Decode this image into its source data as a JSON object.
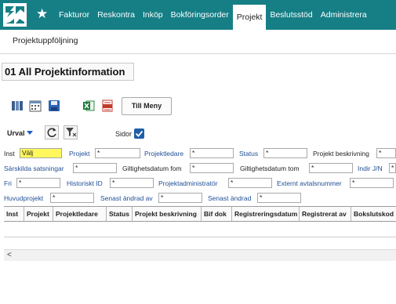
{
  "nav": {
    "star": "★",
    "items": [
      {
        "label": "Fakturor"
      },
      {
        "label": "Reskontra"
      },
      {
        "label": "Inköp"
      },
      {
        "label": "Bokföringsorder"
      },
      {
        "label": "Projekt",
        "active": true
      },
      {
        "label": "Beslutsstöd"
      },
      {
        "label": "Administrera"
      }
    ]
  },
  "subnav": {
    "label": "Projektuppföljning"
  },
  "page": {
    "title": "01 All Projektinformation"
  },
  "toolbar": {
    "meny_label": "Till Meny",
    "icons": [
      "columns-icon",
      "calendar-icon",
      "save-icon",
      "excel-icon",
      "pdf-icon"
    ]
  },
  "urval": {
    "label": "Urval",
    "sidor_label": "Sidor",
    "sidor_checked": true
  },
  "form": {
    "inst": {
      "label": "Inst",
      "value": "Välj"
    },
    "projekt": {
      "label": "Projekt",
      "value": "*"
    },
    "projektledare": {
      "label": "Projektledare",
      "value": "*"
    },
    "status": {
      "label": "Status",
      "value": "*"
    },
    "projekt_beskrivning": {
      "label": "Projekt beskrivning",
      "value": "*"
    },
    "sarskilda": {
      "label": "Särskilda satsningar",
      "value": "*"
    },
    "giltig_fom": {
      "label": "Giltighetsdatum fom",
      "value": "*"
    },
    "giltig_tom": {
      "label": "Giltighetsdatum tom",
      "value": "*"
    },
    "indir": {
      "label": "Indir J/N",
      "value": "*"
    },
    "fri": {
      "label": "Fri",
      "value": "*"
    },
    "historiskt": {
      "label": "Historiskt ID",
      "value": "*"
    },
    "projektadmin": {
      "label": "Projektadministratör",
      "value": "*"
    },
    "externt": {
      "label": "Externt avtalsnummer",
      "value": "*"
    },
    "huvudprojekt": {
      "label": "Huvudprojekt",
      "value": "*"
    },
    "senast_av": {
      "label": "Senast ändrad av",
      "value": "*"
    },
    "senast": {
      "label": "Senast ändrad",
      "value": "*"
    }
  },
  "table": {
    "columns": [
      "Inst",
      "Projekt",
      "Projektledare",
      "Status",
      "Projekt beskrivning",
      "Bif dok",
      "Registreringsdatum",
      "Registrerat av",
      "Bokslutskod"
    ]
  },
  "scroll": {
    "left_arrow": "<"
  }
}
